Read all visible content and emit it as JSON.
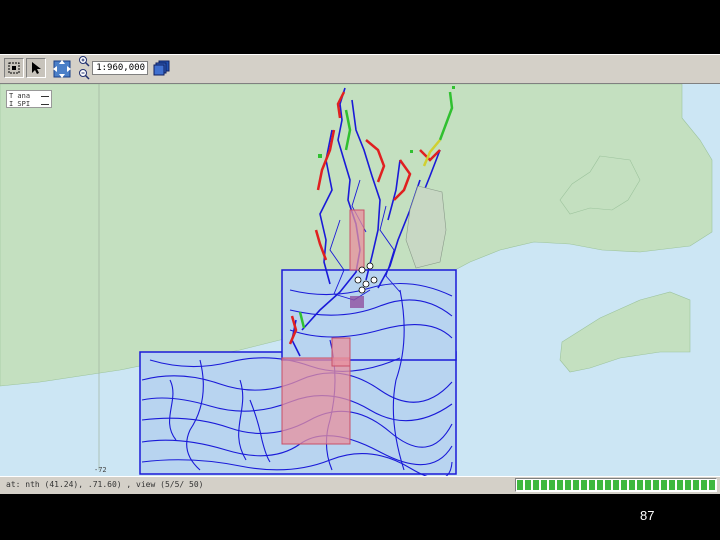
{
  "toolbar": {
    "buttons": [
      {
        "name": "select-region-icon"
      },
      {
        "name": "pointer-icon"
      },
      {
        "name": "pan-icon"
      },
      {
        "name": "zoom-in-icon"
      },
      {
        "name": "zoom-out-icon"
      },
      {
        "name": "layers-icon"
      }
    ],
    "scale_value": "1:960,000"
  },
  "legend": {
    "rows": [
      "T ana",
      "I SPI"
    ]
  },
  "map": {
    "axis_tick_label": "-72",
    "colors": {
      "land": "#c4e0c0",
      "water": "#cce6f4",
      "contour": "#1a1ad8",
      "highlight": "#e8909e",
      "red_track": "#e02020",
      "green_track": "#30c030"
    }
  },
  "status": {
    "coords_text": "at: nth (41.24), .71.60) , view (5/5/ 50)",
    "progress_fraction": 1.0,
    "progress_color": "#3fb83f"
  },
  "slide": {
    "page_number": "87"
  }
}
